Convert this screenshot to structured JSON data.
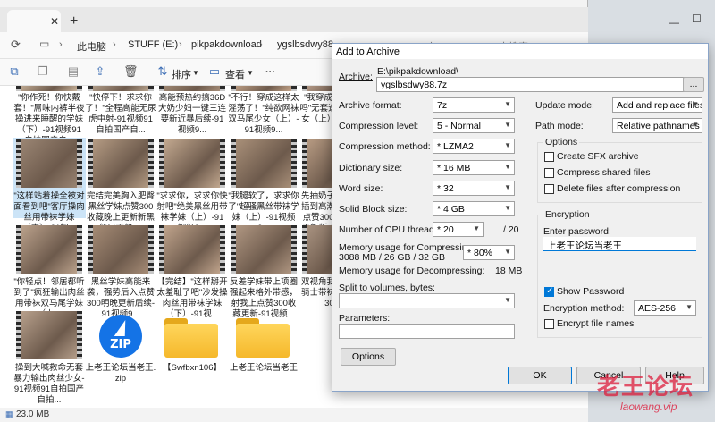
{
  "explorer": {
    "breadcrumb": [
      "此电脑",
      "STUFF (E:)",
      "pikpakdownload",
      "ygslbsdwy88"
    ],
    "search_placeholder": "在 ygslbsdwy88 中搜索",
    "toolbar": {
      "sort_label": "排序",
      "view_label": "查看",
      "more_label": "···"
    },
    "files": [
      {
        "name": "\"你作死！你快戴套！\"屌味内裤半夜操进来睡醒的学妹（下）-91视频91自拍国产自...",
        "thumb": "#c9b39a"
      },
      {
        "name": "\"快停下！求求你了！\"全程高能无尿虎中射-91视频91自拍国产自...",
        "thumb": "#b8a48f"
      },
      {
        "name": "高能预热约搞36D大奶少妇一键三连要新近暴后续-91视频9...",
        "thumb": "#a58d78"
      },
      {
        "name": "\"不行！穿成这样太淫荡了！\"纯欲网袜双马尾少女（上）-91视频9...",
        "thumb": "#c5a58a"
      },
      {
        "name": "\"我穿成这样好看吗\"无套速插学妹少女（上）91视频...",
        "thumb": "#bda18e"
      },
      {
        "name": "\"这样站着操全被对面看到吧\"客厅操肉丝用带袜学妹（中）-91视...",
        "thumb": "#9a8573",
        "selected": true
      },
      {
        "name": "完结完美胸入肥臀黑丝学妹点赞300收藏晚上更新新黑丝足委熟-...",
        "thumb": "#b49b83"
      },
      {
        "name": "\"求求你，求求你快射吧\"绝美黑丝用带袜学妹（上）-91视频9...",
        "thumb": "#c2a88f"
      },
      {
        "name": "\"我腿软了，求求你了\"超骚黑丝带袜学妹（上）-91视频9...",
        "thumb": "#a99079"
      },
      {
        "name": "先抽奶子再暴力抽插到高潮青筋暴起点赞300收藏明晚更新版-91视频9...",
        "thumb": "#b69a82"
      },
      {
        "name": "\"你轻点！邻居都听到了\"疯狂输出肉丝用带袜双马尾学妹（上...",
        "thumb": "#bba28c"
      },
      {
        "name": "黑丝学妹高能来袭，强势后入点赞300明晚更新后续-91视频9...",
        "thumb": "#a68c76"
      },
      {
        "name": "【完结】\"这样掰开太羞耻了吧\"沙发操肉丝用带袜学妹（下）-91视...",
        "thumb": "#c0a48c"
      },
      {
        "name": "反差学妹带上项圈强起来格外带感，射我上点赞300收藏更新-91视频...",
        "thumb": "#b09782"
      },
      {
        "name": "双视角我玩着丝袜骑士带袜学妹点赞300...",
        "thumb": "#a89280"
      },
      {
        "name": "操到大喊救命无套暴力输出肉丝少女-91视频91自拍国产自拍...",
        "thumb": "#b7a08c"
      },
      {
        "name": "上老王论坛当老王.zip",
        "type": "zip"
      },
      {
        "name": "【Swfbxn106】",
        "type": "folder"
      },
      {
        "name": "上老王论坛当老王",
        "type": "folder"
      }
    ],
    "status": {
      "size_text": "23.0 MB"
    }
  },
  "dialog": {
    "title": "Add to Archive",
    "archive_label": "Archive:",
    "archive_path": "E:\\pikpakdownload\\",
    "archive_name": "ygslbsdwy88.7z",
    "browse_label": "...",
    "format_label": "Archive format:",
    "format_value": "7z",
    "level_label": "Compression level:",
    "level_value": "5 - Normal",
    "method_label": "Compression method:",
    "method_value": "* LZMA2",
    "dict_label": "Dictionary size:",
    "dict_value": "* 16 MB",
    "word_label": "Word size:",
    "word_value": "* 32",
    "block_label": "Solid Block size:",
    "block_value": "* 4 GB",
    "threads_label": "Number of CPU threads:",
    "threads_value": "* 20",
    "threads_max": "/ 20",
    "mem_comp_label": "Memory usage for Compressing:",
    "mem_comp_value": "3088 MB / 26 GB / 32 GB",
    "mem_percent": "* 80%",
    "mem_decomp_label": "Memory usage for Decompressing:",
    "mem_decomp_value": "18 MB",
    "split_label": "Split to volumes, bytes:",
    "params_label": "Parameters:",
    "options_button": "Options",
    "update_label": "Update mode:",
    "update_value": "Add and replace files",
    "path_label": "Path mode:",
    "path_value": "Relative pathnames",
    "options_title": "Options",
    "opt_sfx": "Create SFX archive",
    "opt_shared": "Compress shared files",
    "opt_delete": "Delete files after compression",
    "enc_title": "Encryption",
    "enc_password_label": "Enter password:",
    "enc_password_value": "上老王论坛当老王",
    "show_password": "Show Password",
    "enc_method_label": "Encryption method:",
    "enc_method_value": "AES-256",
    "enc_names": "Encrypt file names",
    "ok": "OK",
    "cancel": "Cancel",
    "help": "Help"
  },
  "watermark": {
    "big": "老王论坛",
    "small": "laowang.vip"
  }
}
